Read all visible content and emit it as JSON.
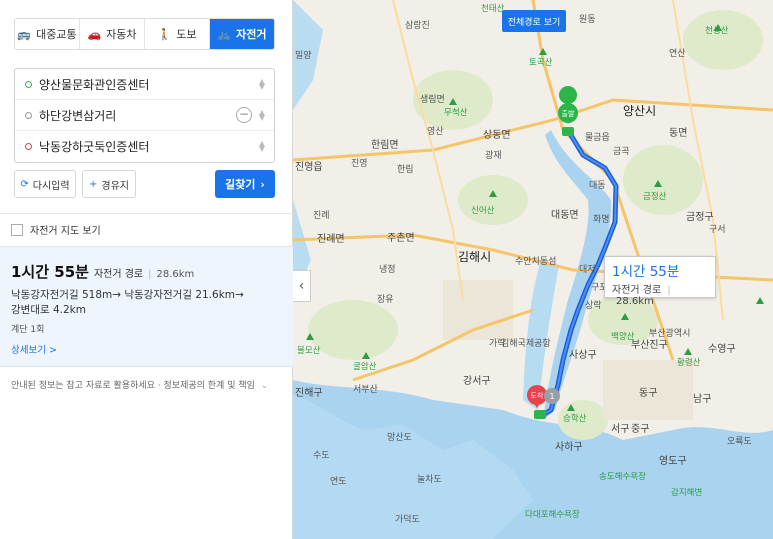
{
  "modes": [
    {
      "icon": "🚌",
      "icon_name": "bus-icon",
      "label": "대중교통",
      "active": false
    },
    {
      "icon": "🚗",
      "icon_name": "car-icon",
      "label": "자동차",
      "active": false
    },
    {
      "icon": "🚶",
      "icon_name": "walk-icon",
      "label": "도보",
      "active": false
    },
    {
      "icon": "🚲",
      "icon_name": "bicycle-icon",
      "label": "자전거",
      "active": true
    }
  ],
  "route": {
    "origin": "양산물문화관인증센터",
    "waypoint": "하단강변삼거리",
    "destination": "낙동강하굿둑인증센터"
  },
  "buttons": {
    "reset": "다시입력",
    "reset_icon": "⟳",
    "waypoint": "경유지",
    "waypoint_icon": "+",
    "search": "길찾기",
    "search_arrow": "›"
  },
  "bike_map_label": "자전거 지도 보기",
  "result": {
    "duration": "1시간 55분",
    "route_type": "자전거 경로",
    "distance": "28.6km",
    "path_line1": "낙동강자전거길 518m→ 낙동강자전거길 21.6km→",
    "path_line2": "강변대로 4.2km",
    "stairs": "계단 1회",
    "detail_link": "상세보기",
    "detail_arrow": ">"
  },
  "notice": "안내된 정보는 참고 자료로 활용하세요 · 정보제공의 한계 및 책임",
  "notice_arrow": "⌄",
  "map": {
    "full_route_button": "전체경로 보기",
    "collapse_icon": "‹",
    "callout_duration": "1시간 55분",
    "callout_type": "자전거 경로",
    "callout_distance": "28.6km",
    "start_marker": "출발",
    "end_marker": "도착",
    "waypoint_marker": "1",
    "labels": [
      {
        "text": "천태산"
      },
      {
        "text": "토곡산"
      },
      {
        "text": "원동"
      },
      {
        "text": "천성산"
      },
      {
        "text": "양산시"
      },
      {
        "text": "생림면"
      },
      {
        "text": "무척산"
      },
      {
        "text": "상동면"
      },
      {
        "text": "한림면"
      },
      {
        "text": "물금읍"
      },
      {
        "text": "동면"
      },
      {
        "text": "진영읍"
      },
      {
        "text": "신어산"
      },
      {
        "text": "대동면"
      },
      {
        "text": "금정산"
      },
      {
        "text": "진례면"
      },
      {
        "text": "주촌면"
      },
      {
        "text": "김해시"
      },
      {
        "text": "금정구"
      },
      {
        "text": "수안치동섬"
      },
      {
        "text": "백양산"
      },
      {
        "text": "부산진구"
      },
      {
        "text": "황령산"
      },
      {
        "text": "수영구"
      },
      {
        "text": "불모산"
      },
      {
        "text": "굴암산"
      },
      {
        "text": "강서구"
      },
      {
        "text": "사상구"
      },
      {
        "text": "진해구"
      },
      {
        "text": "가덕도"
      },
      {
        "text": "망산도"
      },
      {
        "text": "눌차도"
      },
      {
        "text": "사하구"
      },
      {
        "text": "승학산"
      },
      {
        "text": "서구"
      },
      {
        "text": "중구"
      },
      {
        "text": "동구"
      },
      {
        "text": "남구"
      },
      {
        "text": "영도구"
      },
      {
        "text": "오륙도"
      },
      {
        "text": "다대포해수욕장"
      },
      {
        "text": "송도해수욕장"
      },
      {
        "text": "감지해변"
      },
      {
        "text": "부산광역시"
      },
      {
        "text": "김해국제공항"
      },
      {
        "text": "연산"
      },
      {
        "text": "수도"
      },
      {
        "text": "연도"
      },
      {
        "text": "대저"
      },
      {
        "text": "상락"
      },
      {
        "text": "구포"
      },
      {
        "text": "대동"
      },
      {
        "text": "화명"
      },
      {
        "text": "삼랑진"
      },
      {
        "text": "밀양"
      },
      {
        "text": "금곡"
      },
      {
        "text": "냉정"
      },
      {
        "text": "장유"
      },
      {
        "text": "가락"
      },
      {
        "text": "서부산"
      },
      {
        "text": "진례"
      },
      {
        "text": "진영"
      },
      {
        "text": "한림"
      },
      {
        "text": "광재"
      },
      {
        "text": "영산"
      },
      {
        "text": "구서"
      }
    ]
  }
}
